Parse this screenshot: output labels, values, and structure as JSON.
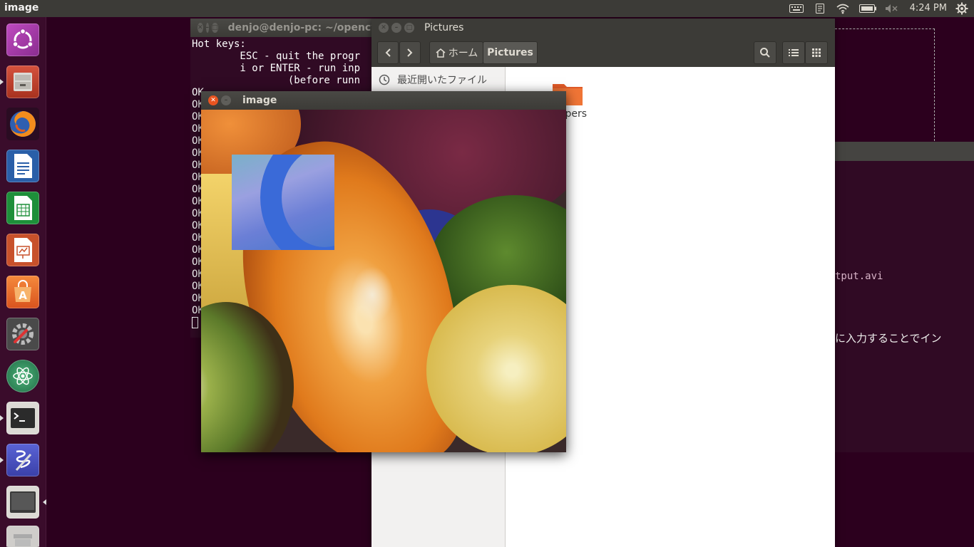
{
  "top_panel": {
    "app_title": "image",
    "clock": "4:24 PM",
    "indicators": [
      "keyboard-icon",
      "notes-icon",
      "wifi-icon",
      "battery-icon",
      "volume-mute-icon",
      "settings-gear-icon"
    ]
  },
  "launcher": {
    "items": [
      "ubuntu-dash",
      "files",
      "firefox",
      "writer",
      "calc",
      "impress",
      "software-center",
      "system-settings",
      "atom",
      "terminal",
      "gedit",
      "workspace-screen",
      "trash"
    ]
  },
  "terminal": {
    "title": "denjo@denjo-pc: ~/opencv",
    "lines": [
      "Hot keys:",
      "        ESC - quit the progr",
      "        i or ENTER - run inp",
      "                (before runn",
      "OK",
      "OK",
      "OK",
      "OK",
      "OK",
      "OK",
      "OK",
      "OK",
      "OK",
      "OK",
      "OK",
      "OK",
      "OK",
      "OK",
      "OK",
      "OK",
      "OK",
      "OK",
      "OK"
    ]
  },
  "files": {
    "title": "Pictures",
    "breadcrumb_home": "ホーム",
    "breadcrumb_current": "Pictures",
    "sidebar_recent": "最近開いたファイル",
    "folder_label": "papers"
  },
  "bg_terminal": {
    "line1": "tput.avi",
    "line2": "に入力することでイン"
  },
  "image_window": {
    "title": "image"
  },
  "colors": {
    "desktop": "#2c001e",
    "terminal_bg": "#300a24",
    "panel": "#3c3b37",
    "close_button": "#e95420"
  }
}
